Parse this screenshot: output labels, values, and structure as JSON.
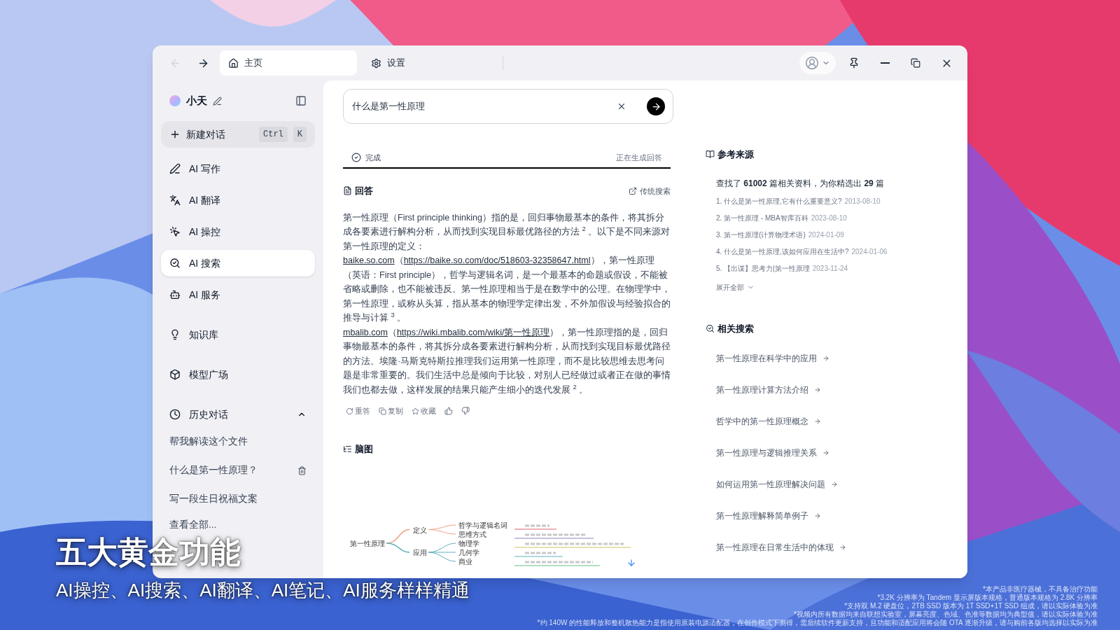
{
  "titlebar": {
    "back_disabled": true,
    "tabs": [
      {
        "label": "主页",
        "selected": true
      },
      {
        "label": "设置",
        "selected": false
      }
    ]
  },
  "sidebar": {
    "user": "小天",
    "new_chat": {
      "label": "新建对话",
      "keys": [
        "Ctrl",
        "K"
      ]
    },
    "items": [
      {
        "label": "AI 写作",
        "selected": false
      },
      {
        "label": "AI 翻译",
        "selected": false
      },
      {
        "label": "AI 操控",
        "selected": false
      },
      {
        "label": "AI 搜索",
        "selected": true
      },
      {
        "label": "AI 服务",
        "selected": false
      },
      {
        "label": "知识库",
        "selected": false
      },
      {
        "label": "模型广场",
        "selected": false
      }
    ],
    "history": {
      "title": "历史对话",
      "expanded": true,
      "items": [
        {
          "label": "帮我解读这个文件",
          "hovered": false
        },
        {
          "label": "什么是第一性原理？",
          "hovered": true
        },
        {
          "label": "写一段生日祝福文案",
          "hovered": false
        }
      ],
      "more": "查看全部..."
    }
  },
  "search": {
    "value": "什么是第一性原理"
  },
  "status": {
    "label": "完成",
    "right": "正在生成回答",
    "level": 1
  },
  "answer": {
    "title": "回答",
    "link": "传统搜索",
    "intro": "第一性原理（First principle thinking）指的是，回归事物最基本的条件，将其拆分成各要素进行解构分析，从而找到实现目标最优路径的方法 $^{2}$ 。以下是不同来源对第一性原理的定义：",
    "sources": [
      {
        "site": "baike.so.com",
        "url": "https://baike.so.com/doc/518603-32358647.html",
        "text": "），第一性原理（英语：First principle），哲学与逻辑名词，是一个最基本的命题或假设，不能被省略或删除，也不能被违反。第一性原理相当于是在数学中的公理。在物理学中，第一性原理，或称从头算，指从基本的物理学定律出发，不外加假设与经验拟合的推导与计算 $^{3}$ 。"
      },
      {
        "site": "mbalib.com",
        "url": "https://wiki.mbalib.com/wiki/第一性原理",
        "text": "），第一性原理指的是，回归事物最基本的条件，将其拆分成各要素进行解构分析，从而找到实现目标最优路径的方法。埃隆·马斯克特斯拉推理我们运用第一性原理，而不是比较思维去思考问题是非常重要的。我们生活中总是倾向于比较，对别人已经做过或者正在做的事情我们也都去做，这样发展的结果只能产生细小的迭代发展 $^{2}$ 。"
      }
    ],
    "open_paren": "（",
    "actions": [
      {
        "kind": "retry",
        "label": "重答"
      },
      {
        "kind": "copy",
        "label": "复制"
      },
      {
        "kind": "save",
        "label": "收藏"
      },
      {
        "kind": "like"
      },
      {
        "kind": "dislike"
      }
    ]
  },
  "mindmap": {
    "title": "脑图",
    "root": "第一性原理",
    "branches": [
      {
        "label": "定义",
        "color": "#f0a080",
        "leaves": [
          "哲学与逻辑名词",
          "思维方式"
        ]
      },
      {
        "label": "应用",
        "color": "#60b0c0",
        "leaves": [
          "物理学",
          "几何学",
          "商业"
        ]
      }
    ]
  },
  "references": {
    "title": "参考来源",
    "summary": "查找了 **61002** 篇相关资料，为你精选出 **29** 篇",
    "items": [
      {
        "title": "1. 什么是第一性原理,它有什么重要意义?",
        "date": "2013-08-10"
      },
      {
        "title": "2. 第一性原理 - MBA智库百科",
        "date": "2023-08-10"
      },
      {
        "title": "3. 第一性原理(计算物理术语)",
        "date": "2024-01-09"
      },
      {
        "title": "4. 什么是第一性原理,该如何应用在生活中?",
        "date": "2024-01-06"
      },
      {
        "title": "5. 【出谋】思考力|第一性原理",
        "date": "2023-11-24"
      }
    ],
    "expand": "展开全部"
  },
  "related": {
    "title": "相关搜索",
    "items": [
      "第一性原理在科学中的应用",
      "第一性原理计算方法介绍",
      "哲学中的第一性原理概念",
      "第一性原理与逻辑推理关系",
      "如何运用第一性原理解决问题",
      "第一性原理解释简单例子",
      "第一性原理在日常生活中的体现"
    ]
  },
  "caption": {
    "title": "五大黄金功能",
    "subtitle": "AI操控、AI搜索、AI翻译、AI笔记、AI服务样样精通"
  },
  "footnotes": [
    "*本产品非医疗器械，不具备治疗功能",
    "*3.2K 分辨率为 Tandem 显示屏版本规格，普通版本规格为 2.8K 分辨率",
    "*支持双 M.2 硬盘位，2TB SSD 版本为 1T SSD+1T SSD 组成，请以实际体验为准",
    "*视频内所有数据均来自联想实验室，屏幕亮度、色域、色准等数据均为典型值，请以实际体验为准",
    "*约 140W 的性能释放和整机散热能力是指使用原装电源适配器，在创作模式下测得，需后续软件更新支持，且功能和适配应用将会随 OTA 逐渐升级，请与购前各版均选择以实际为准"
  ]
}
